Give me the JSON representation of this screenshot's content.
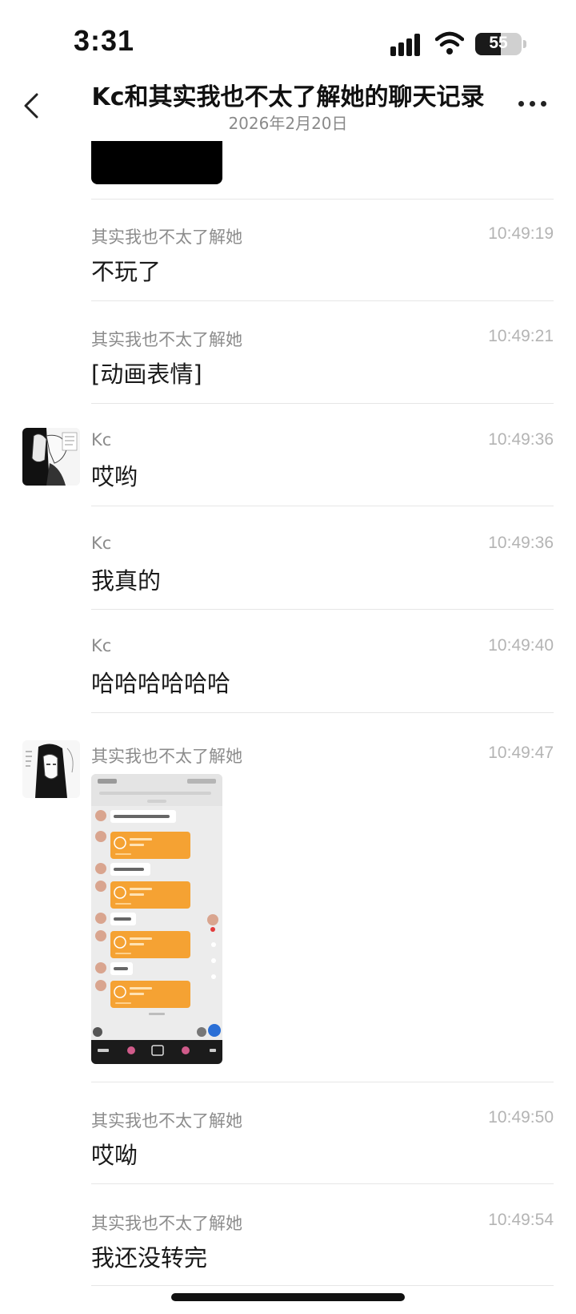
{
  "status": {
    "time": "3:31",
    "battery": "55",
    "battery_level": 0.55
  },
  "nav": {
    "back_icon": "chevron-left-icon",
    "title": "Kc和其实我也不太了解她的聊天记录",
    "subtitle": "2026年2月20日",
    "more_icon": "more-dots-icon"
  },
  "messages": [
    {
      "sender": "其实我也不太了解她",
      "time": "10:49:19",
      "text": "不玩了"
    },
    {
      "sender": "其实我也不太了解她",
      "time": "10:49:21",
      "text": "[动画表情]"
    },
    {
      "sender": "Kc",
      "time": "10:49:36",
      "text": "哎哟"
    },
    {
      "sender": "Kc",
      "time": "10:49:36",
      "text": "我真的"
    },
    {
      "sender": "Kc",
      "time": "10:49:40",
      "text": "哈哈哈哈哈哈"
    },
    {
      "sender": "其实我也不太了解她",
      "time": "10:49:47",
      "text": ""
    },
    {
      "sender": "其实我也不太了解她",
      "time": "10:49:50",
      "text": "哎呦"
    },
    {
      "sender": "其实我也不太了解她",
      "time": "10:49:54",
      "text": "我还没转完"
    }
  ]
}
